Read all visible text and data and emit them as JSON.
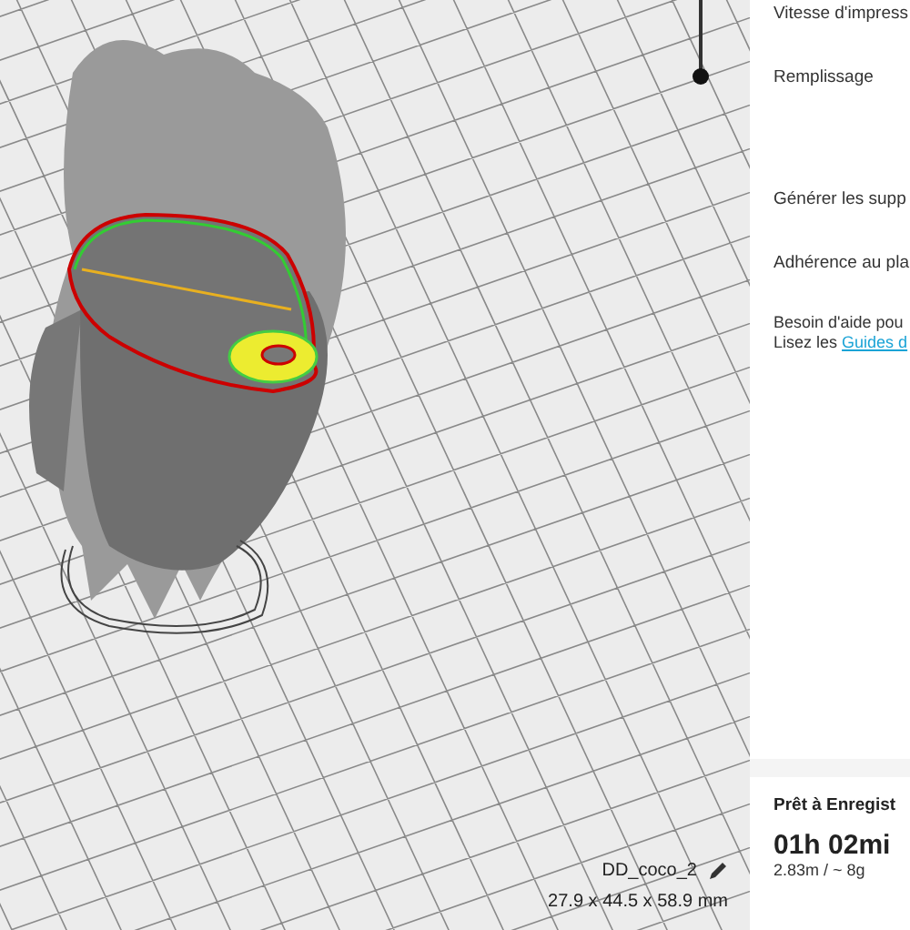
{
  "viewport": {
    "model_name": "DD_coco_2",
    "dimensions": "27.9 x 44.5 x 58.9 mm"
  },
  "settings": [
    {
      "label": "Vitesse d'impress"
    },
    {
      "label": "Remplissage"
    },
    {
      "label": "Générer les supp"
    },
    {
      "label": "Adhérence au pla"
    }
  ],
  "help": {
    "line_1": "Besoin d'aide pou",
    "line_2_prefix": "Lisez les ",
    "link": "Guides d"
  },
  "status": {
    "title": "Prêt à Enregist",
    "time": "01h 02mi",
    "usage": "2.83m / ~ 8g"
  }
}
